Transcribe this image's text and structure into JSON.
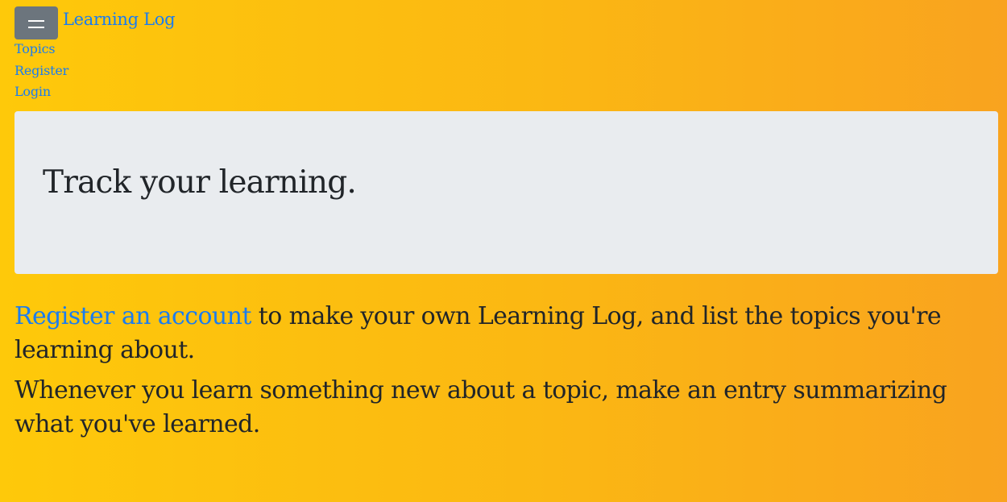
{
  "navbar": {
    "toggler_icon": "hamburger-icon",
    "brand": "Learning Log",
    "links": [
      "Topics",
      "Register",
      "Login"
    ]
  },
  "jumbotron": {
    "heading": "Track your learning."
  },
  "content": {
    "p1_link": "Register an account",
    "p1_rest": " to make your own Learning Log, and list the topics you're learning about.",
    "p2": "Whenever you learn something new about a topic, make an entry summarizing what you've learned."
  },
  "colors": {
    "background_start": "#fec90a",
    "background_end": "#f9a31f",
    "link": "#1a7cf0",
    "toggler": "#6c757d",
    "jumbotron": "#e9ecef",
    "text": "#212529"
  }
}
